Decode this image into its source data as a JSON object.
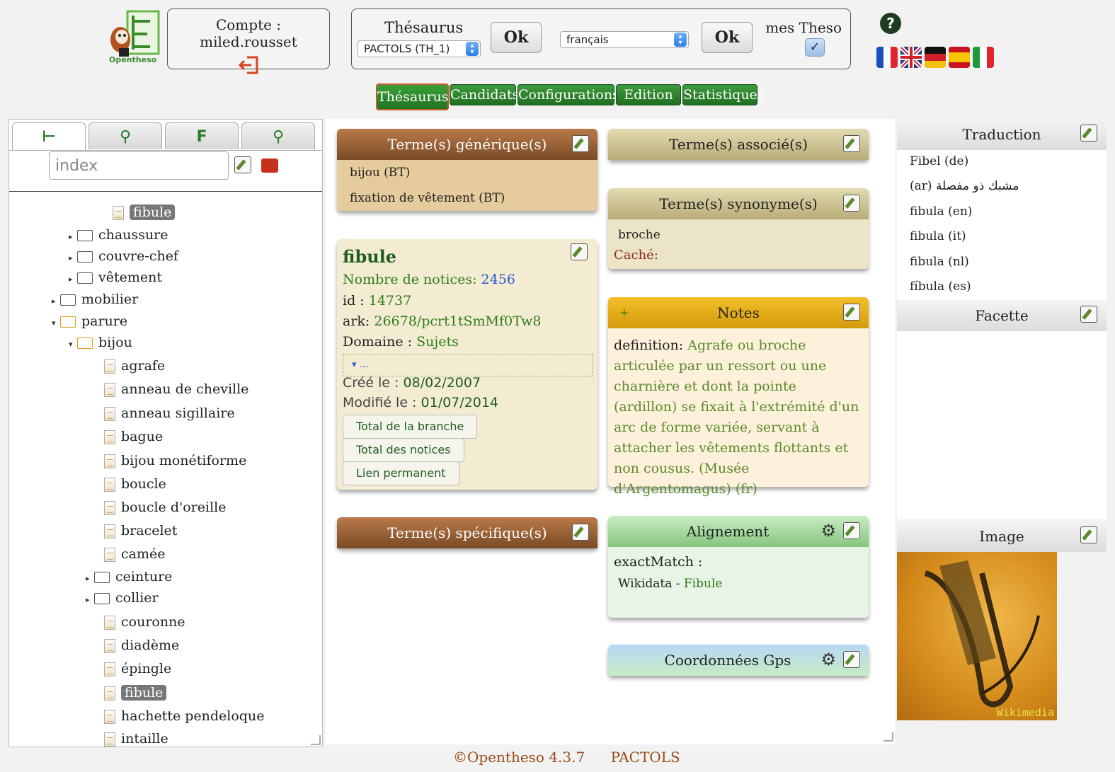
{
  "header": {
    "logo_text": "Opentheso",
    "account_label": "Compte : miled.rousset",
    "thesaurus_label": "Thésaurus",
    "thesaurus_selected": "PACTOLS (TH_1)",
    "ok_label": "Ok",
    "language_selected": "français",
    "ok2_label": "Ok",
    "mes_theso_label": "mes Theso",
    "help_symbol": "?"
  },
  "menu": [
    "Thésaurus",
    "Candidats",
    "Configurations",
    "Edition",
    "Statistiques"
  ],
  "tree": {
    "search_placeholder": "index",
    "top_selected": "fibule",
    "nodes": [
      {
        "label": "chaussure",
        "type": "folder"
      },
      {
        "label": "couvre-chef",
        "type": "folder"
      },
      {
        "label": "vêtement",
        "type": "folder"
      },
      {
        "label": "mobilier",
        "type": "folder"
      },
      {
        "label": "parure",
        "type": "folder-open"
      },
      {
        "label": "bijou",
        "type": "folder-open"
      },
      {
        "label": "agrafe",
        "type": "doc"
      },
      {
        "label": "anneau de cheville",
        "type": "doc"
      },
      {
        "label": "anneau sigillaire",
        "type": "doc"
      },
      {
        "label": "bague",
        "type": "doc"
      },
      {
        "label": "bijou monétiforme",
        "type": "doc"
      },
      {
        "label": "boucle",
        "type": "doc"
      },
      {
        "label": "boucle d'oreille",
        "type": "doc"
      },
      {
        "label": "bracelet",
        "type": "doc"
      },
      {
        "label": "camée",
        "type": "doc"
      },
      {
        "label": "ceinture",
        "type": "folder"
      },
      {
        "label": "collier",
        "type": "folder"
      },
      {
        "label": "couronne",
        "type": "doc"
      },
      {
        "label": "diadème",
        "type": "doc"
      },
      {
        "label": "épingle",
        "type": "doc"
      },
      {
        "label": "fibule",
        "type": "doc-selected"
      },
      {
        "label": "hachette pendeloque",
        "type": "doc"
      },
      {
        "label": "intaille",
        "type": "doc"
      }
    ]
  },
  "generic": {
    "title": "Terme(s) générique(s)",
    "items": [
      "bijou (BT)",
      "fixation de vêtement (BT)"
    ]
  },
  "concept": {
    "name": "fibule",
    "notices_label": "Nombre de notices:",
    "notices_value": "2456",
    "id_label": "id :",
    "id_value": "14737",
    "ark_label": "ark:",
    "ark_value": "26678/pcrt1tSmMf0Tw8",
    "domain_label": "Domaine :",
    "domain_value": "Sujets",
    "collapse_text": "▾ ...",
    "created_label": "Créé le :",
    "created_value": "08/02/2007",
    "modified_label": "Modifié le :",
    "modified_value": "01/07/2014",
    "btn_branch": "Total de la branche",
    "btn_notices": "Total des notices",
    "btn_link": "Lien permanent"
  },
  "specific": {
    "title": "Terme(s) spécifique(s)"
  },
  "associated": {
    "title": "Terme(s) associé(s)"
  },
  "synonyms": {
    "title": "Terme(s) synonyme(s)",
    "item": "broche",
    "hidden_label": "Caché:"
  },
  "notes": {
    "title": "Notes",
    "plus": "+",
    "def_label": "definition:",
    "def_text": "Agrafe ou broche articulée par un ressort ou une charnière et dont la pointe (ardillon) se fixait à l'extrémité d'un arc de forme variée, servant à attacher les vêtements flottants et non cousus. (Musée d'Argentomagus) (fr)"
  },
  "alignment": {
    "title": "Alignement",
    "match_label": "exactMatch :",
    "source": "Wikidata -",
    "target": "Fibule"
  },
  "gps": {
    "title": "Coordonnées Gps"
  },
  "translation": {
    "title": "Traduction",
    "items": [
      "Fibel (de)",
      "(ar) مشبك ذو مفصلة",
      "fibula (en)",
      "fibula (it)",
      "fibula (nl)",
      "fíbula (es)"
    ]
  },
  "facet": {
    "title": "Facette"
  },
  "image": {
    "title": "Image",
    "watermark": "Wikimedia"
  },
  "footer": {
    "version": "©Opentheso 4.3.7",
    "thesaurus": "PACTOLS"
  },
  "colors": {
    "accent_green": "#2e7d1a",
    "menu_green": "#2d862d",
    "brown": "#7a4a24"
  }
}
